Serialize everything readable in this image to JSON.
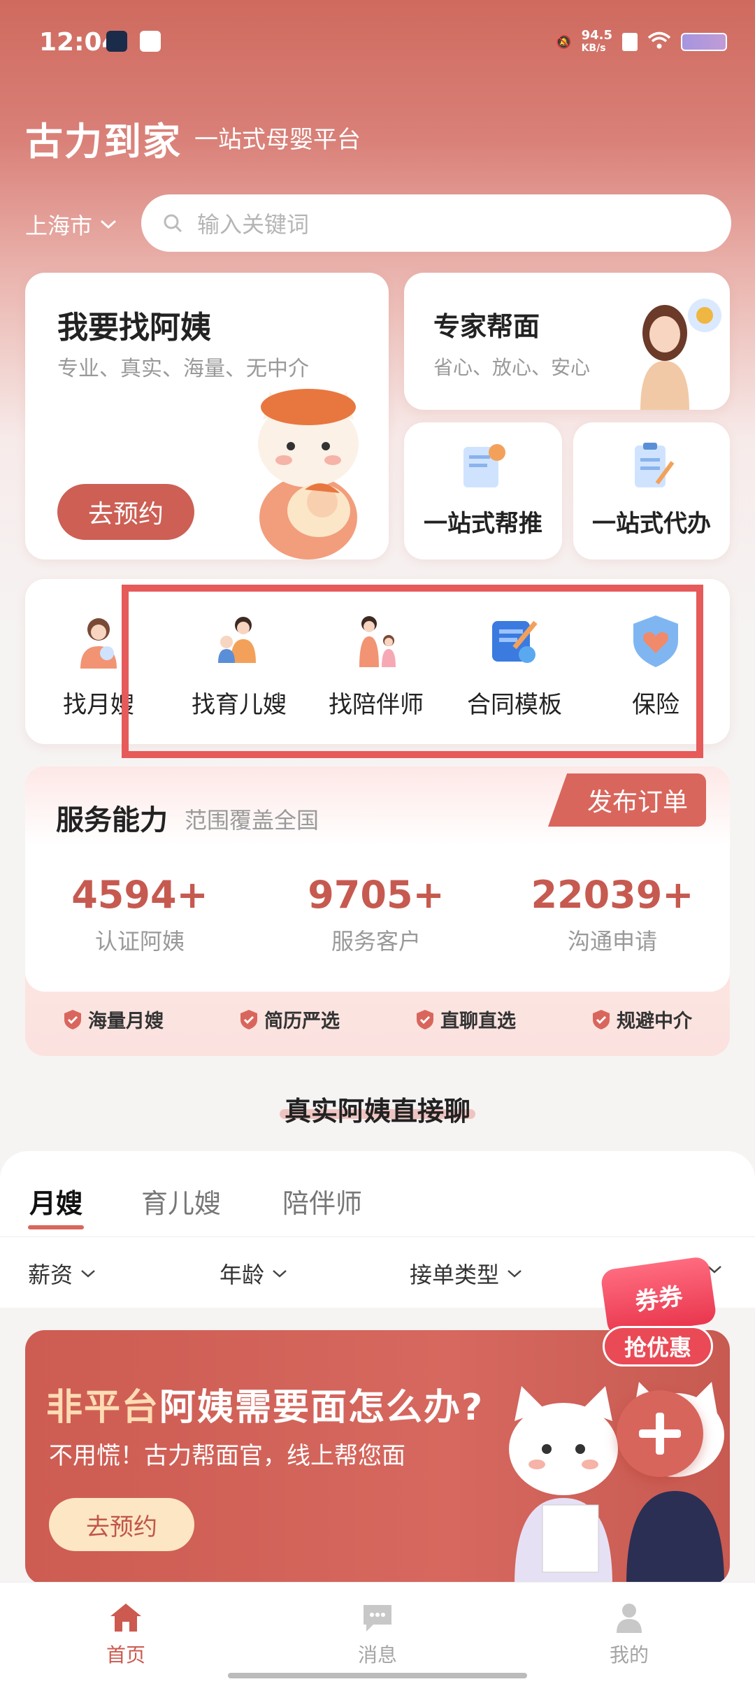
{
  "status_bar": {
    "time": "12:04",
    "net_speed": "94.5",
    "net_unit": "KB/s"
  },
  "header": {
    "brand": "古力到家",
    "slogan": "一站式母婴平台"
  },
  "location": {
    "city": "上海市"
  },
  "search": {
    "placeholder": "输入关键词"
  },
  "main_card": {
    "title": "我要找阿姨",
    "subtitle": "专业、真实、海量、无中介",
    "button": "去预约"
  },
  "expert_card": {
    "title": "专家帮面",
    "subtitle": "省心、放心、安心"
  },
  "small_cards": [
    {
      "label": "一站式帮推"
    },
    {
      "label": "一站式代办"
    }
  ],
  "quick_links": [
    {
      "label": "找月嫂"
    },
    {
      "label": "找育儿嫂"
    },
    {
      "label": "找陪伴师"
    },
    {
      "label": "合同模板"
    },
    {
      "label": "保险"
    }
  ],
  "service": {
    "title": "服务能力",
    "subtitle": "范围覆盖全国",
    "publish_button": "发布订单",
    "stats": [
      {
        "value": "4594+",
        "label": "认证阿姨"
      },
      {
        "value": "9705+",
        "label": "服务客户"
      },
      {
        "value": "22039+",
        "label": "沟通申请"
      }
    ],
    "badges": [
      "海量月嫂",
      "简历严选",
      "直聊直选",
      "规避中介"
    ]
  },
  "section": {
    "title": "真实阿姨直接聊"
  },
  "tabs": [
    {
      "label": "月嫂"
    },
    {
      "label": "育儿嫂"
    },
    {
      "label": "陪伴师"
    }
  ],
  "filters": [
    {
      "label": "薪资"
    },
    {
      "label": "年龄"
    },
    {
      "label": "接单类型"
    }
  ],
  "coupon": {
    "tag": "券券",
    "button": "抢优惠"
  },
  "banner": {
    "title_highlight": "非平台",
    "title_rest": "阿姨需要面怎么办?",
    "subtitle": "不用慌！古力帮面官，线上帮您面",
    "button": "去预约"
  },
  "bottom_nav": [
    {
      "label": "首页"
    },
    {
      "label": "消息"
    },
    {
      "label": "我的"
    }
  ],
  "colors": {
    "primary": "#cd5f55",
    "highlight_box": "#e65a5a"
  }
}
